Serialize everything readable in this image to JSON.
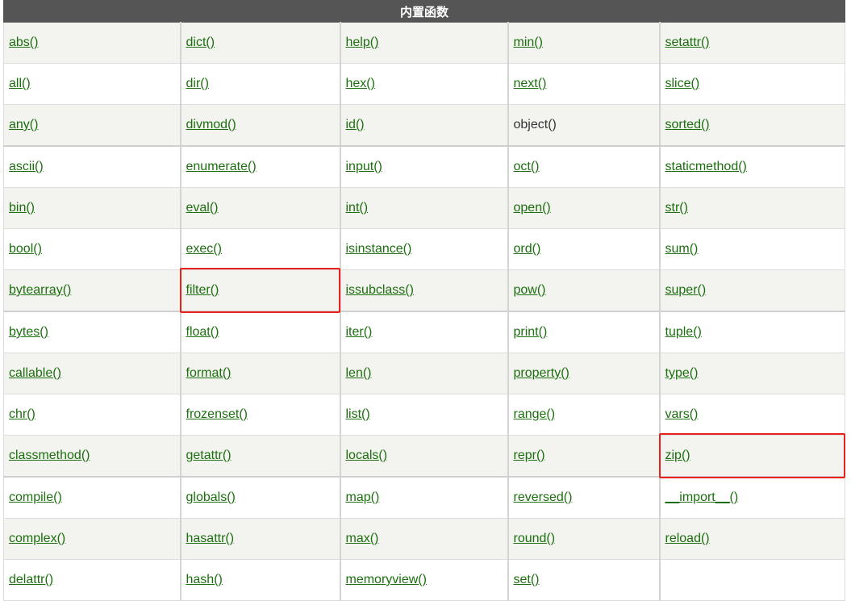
{
  "table": {
    "title": "内置函数",
    "accent_color": "#555555",
    "link_color": "#1c6f0f",
    "highlight_color": "#e8211d",
    "rows": [
      [
        {
          "text": "abs()",
          "link": true
        },
        {
          "text": "dict()",
          "link": true
        },
        {
          "text": "help()",
          "link": true
        },
        {
          "text": "min()",
          "link": true
        },
        {
          "text": "setattr()",
          "link": true
        }
      ],
      [
        {
          "text": "all()",
          "link": true
        },
        {
          "text": "dir()",
          "link": true
        },
        {
          "text": "hex()",
          "link": true
        },
        {
          "text": "next()",
          "link": true
        },
        {
          "text": "slice()",
          "link": true
        }
      ],
      [
        {
          "text": "any()",
          "link": true
        },
        {
          "text": "divmod()",
          "link": true
        },
        {
          "text": "id()",
          "link": true
        },
        {
          "text": "object()",
          "link": false
        },
        {
          "text": "sorted()",
          "link": true
        }
      ],
      [
        {
          "text": "ascii()",
          "link": true
        },
        {
          "text": "enumerate()",
          "link": true
        },
        {
          "text": "input()",
          "link": true
        },
        {
          "text": "oct()",
          "link": true
        },
        {
          "text": "staticmethod()",
          "link": true
        }
      ],
      [
        {
          "text": "bin()",
          "link": true
        },
        {
          "text": "eval()",
          "link": true
        },
        {
          "text": "int()",
          "link": true
        },
        {
          "text": "open()",
          "link": true
        },
        {
          "text": "str()",
          "link": true
        }
      ],
      [
        {
          "text": "bool()",
          "link": true
        },
        {
          "text": "exec()",
          "link": true
        },
        {
          "text": "isinstance()",
          "link": true
        },
        {
          "text": "ord()",
          "link": true
        },
        {
          "text": "sum()",
          "link": true
        }
      ],
      [
        {
          "text": "bytearray()",
          "link": true
        },
        {
          "text": "filter()",
          "link": true,
          "highlighted": true
        },
        {
          "text": "issubclass()",
          "link": true
        },
        {
          "text": "pow()",
          "link": true
        },
        {
          "text": "super()",
          "link": true
        }
      ],
      [
        {
          "text": "bytes()",
          "link": true
        },
        {
          "text": "float()",
          "link": true
        },
        {
          "text": "iter()",
          "link": true
        },
        {
          "text": "print()",
          "link": true
        },
        {
          "text": "tuple()",
          "link": true
        }
      ],
      [
        {
          "text": "callable()",
          "link": true
        },
        {
          "text": "format()",
          "link": true
        },
        {
          "text": "len()",
          "link": true
        },
        {
          "text": "property()",
          "link": true
        },
        {
          "text": "type()",
          "link": true
        }
      ],
      [
        {
          "text": "chr()",
          "link": true
        },
        {
          "text": "frozenset()",
          "link": true
        },
        {
          "text": "list()",
          "link": true
        },
        {
          "text": "range()",
          "link": true
        },
        {
          "text": "vars()",
          "link": true
        }
      ],
      [
        {
          "text": "classmethod()",
          "link": true
        },
        {
          "text": "getattr()",
          "link": true
        },
        {
          "text": "locals()",
          "link": true
        },
        {
          "text": "repr()",
          "link": true
        },
        {
          "text": "zip()",
          "link": true,
          "highlighted": true
        }
      ],
      [
        {
          "text": "compile()",
          "link": true
        },
        {
          "text": "globals()",
          "link": true
        },
        {
          "text": "map()",
          "link": true
        },
        {
          "text": "reversed()",
          "link": true
        },
        {
          "text": "__import__()",
          "link": true
        }
      ],
      [
        {
          "text": "complex()",
          "link": true
        },
        {
          "text": "hasattr()",
          "link": true
        },
        {
          "text": "max()",
          "link": true
        },
        {
          "text": "round()",
          "link": true
        },
        {
          "text": "reload()",
          "link": true
        }
      ],
      [
        {
          "text": "delattr()",
          "link": true
        },
        {
          "text": "hash()",
          "link": true
        },
        {
          "text": "memoryview()",
          "link": true
        },
        {
          "text": "set()",
          "link": true
        },
        {
          "text": "",
          "link": false
        }
      ]
    ]
  }
}
